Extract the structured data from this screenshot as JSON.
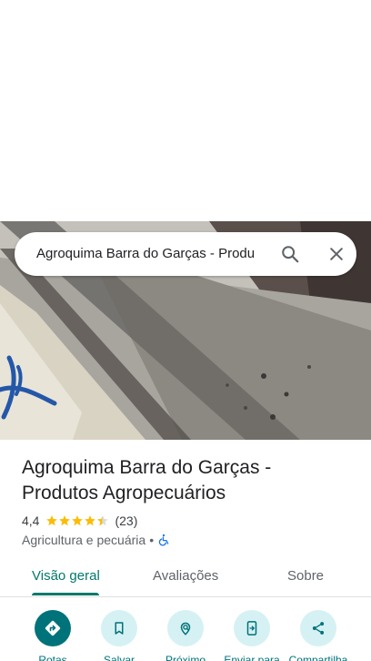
{
  "search": {
    "query": "Agroquima Barra do Garças - Produ"
  },
  "place": {
    "title": "Agroquima Barra do Garças - Produtos Agropecuários",
    "rating": "4,4",
    "rating_stars": 4.4,
    "review_count": "(23)",
    "category": "Agricultura e pecuária",
    "separator": "•"
  },
  "tabs": [
    {
      "label": "Visão geral",
      "active": true
    },
    {
      "label": "Avaliações",
      "active": false
    },
    {
      "label": "Sobre",
      "active": false
    }
  ],
  "actions": [
    {
      "label": "Rotas",
      "icon": "directions-icon"
    },
    {
      "label": "Salvar",
      "icon": "bookmark-icon"
    },
    {
      "label": "Próximo",
      "icon": "nearby-icon"
    },
    {
      "label": "Enviar para",
      "icon": "send-to-phone-icon"
    },
    {
      "label": "Compartilha",
      "icon": "share-icon"
    }
  ],
  "colors": {
    "accent": "#00796b",
    "action_bg": "#d6f1f3",
    "action_primary": "#00727a",
    "star": "#fbbc04",
    "accessibility": "#1a73e8"
  }
}
